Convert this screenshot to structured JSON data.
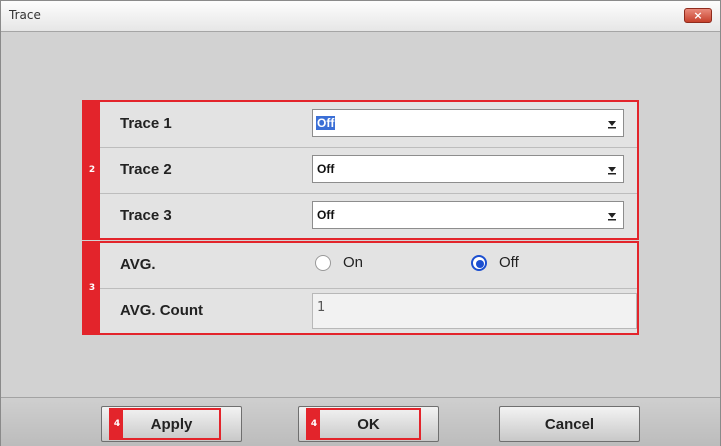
{
  "window": {
    "title": "Trace",
    "close_label": "×"
  },
  "trace_group": {
    "marker": "2",
    "rows": [
      {
        "label": "Trace  1",
        "value": "Off"
      },
      {
        "label": "Trace  2",
        "value": "Off"
      },
      {
        "label": "Trace  3",
        "value": "Off"
      }
    ]
  },
  "avg_group": {
    "marker": "3",
    "avg_label": "AVG.",
    "on_label": "On",
    "off_label": "Off",
    "selected": "Off",
    "count_label": "AVG. Count",
    "count_value": "1"
  },
  "footer": {
    "apply_label": "Apply",
    "apply_marker": "4",
    "ok_label": "OK",
    "ok_marker": "4",
    "cancel_label": "Cancel"
  },
  "colors": {
    "highlight_red": "#e3242b",
    "radio_blue": "#1c4fd0"
  }
}
